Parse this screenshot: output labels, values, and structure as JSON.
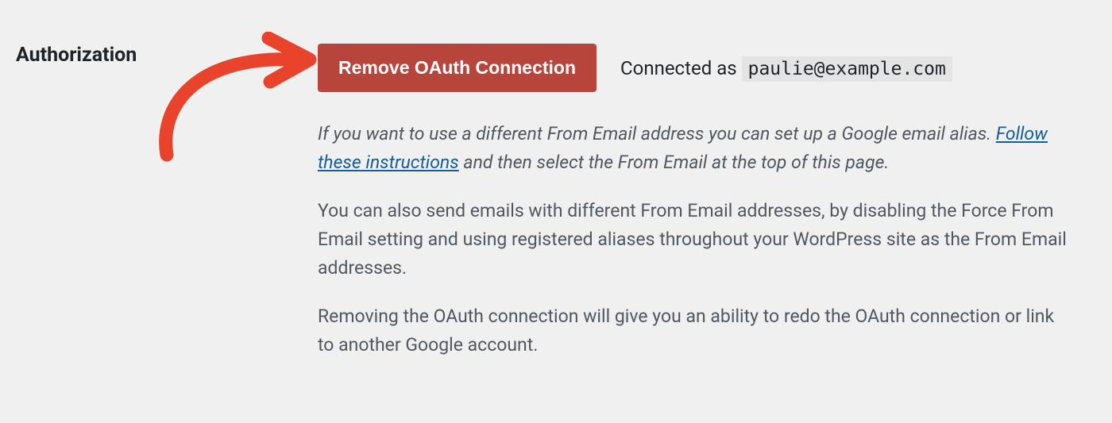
{
  "section": {
    "label": "Authorization"
  },
  "button": {
    "remove_label": "Remove OAuth Connection"
  },
  "status": {
    "connected_label": "Connected as",
    "email": "paulie@example.com"
  },
  "help": {
    "p1_prefix": "If you want to use a different From Email address you can set up a Google email alias. ",
    "p1_link": "Follow these instructions",
    "p1_suffix": " and then select the From Email at the top of this page.",
    "p2": "You can also send emails with different From Email addresses, by disabling the Force From Email setting and using registered aliases throughout your WordPress site as the From Email addresses.",
    "p3": "Removing the OAuth connection will give you an ability to redo the OAuth connection or link to another Google account."
  },
  "colors": {
    "button_bg": "#b8453b",
    "link": "#135e96",
    "arrow": "#e9432c"
  }
}
